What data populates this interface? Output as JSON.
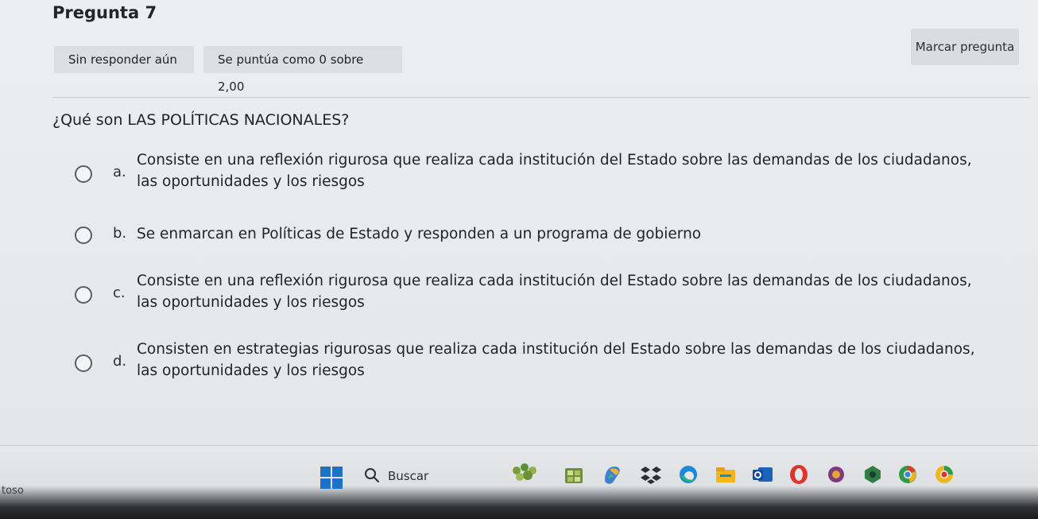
{
  "question": {
    "title": "Pregunta 7",
    "state": "Sin responder aún",
    "grade": "Se puntúa como 0 sobre 2,00",
    "flag_label": "Marcar pregunta",
    "prompt": "¿Qué son LAS POLÍTICAS NACIONALES?"
  },
  "options": [
    {
      "letter": "a.",
      "text": "Consiste en una reflexión rigurosa que realiza cada institución del Estado sobre las demandas de los ciudadanos, las oportunidades y los riesgos"
    },
    {
      "letter": "b.",
      "text": "Se enmarcan en Políticas de Estado y responden a un programa de gobierno"
    },
    {
      "letter": "c.",
      "text": "Consiste en una reflexión rigurosa que realiza cada institución del Estado sobre las demandas de los ciudadanos, las oportunidades y los riesgos"
    },
    {
      "letter": "d.",
      "text": "Consisten en estrategias rigurosas que realiza cada institución del Estado sobre las demandas de los ciudadanos, las oportunidades y los riesgos"
    }
  ],
  "taskbar": {
    "left_text": "toso",
    "search_label": "Buscar",
    "icons": [
      "start-icon",
      "search-icon",
      "widgets-icon",
      "store-icon",
      "copilot-icon",
      "dropbox-icon",
      "edge-icon",
      "file-explorer-icon",
      "outlook-icon",
      "opera-icon",
      "app-icon",
      "app-green-icon",
      "chrome-icon",
      "chrome-canary-icon"
    ]
  },
  "colors": {
    "page_background": "#e9eaec",
    "badge_background": "#dcdee1",
    "start_blue": "#1a73c9",
    "edge_blue": "#1e88d6",
    "opera_red": "#e0332b",
    "chrome_green": "#2f9a4a",
    "chrome_yellow": "#f2b51b"
  }
}
